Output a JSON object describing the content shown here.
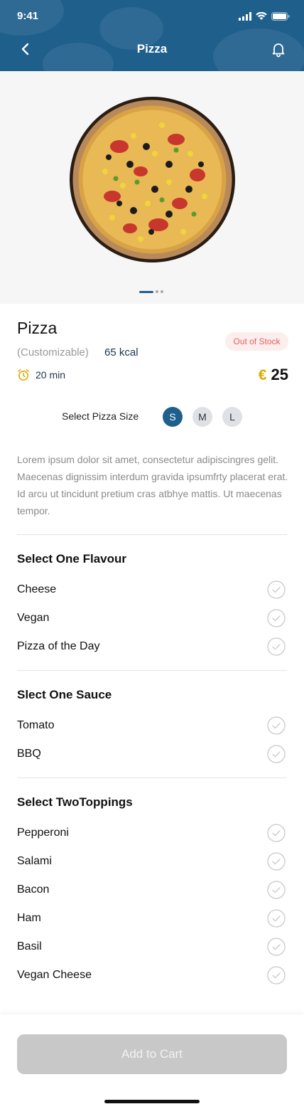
{
  "status_bar": {
    "time": "9:41"
  },
  "nav": {
    "title": "Pizza"
  },
  "product": {
    "name": "Pizza",
    "customizable": "(Customizable)",
    "kcal": "65 kcal",
    "stock_badge": "Out of Stock",
    "time": "20 min",
    "currency": "€",
    "price": "25",
    "size_label": "Select Pizza Size",
    "sizes": [
      "S",
      "M",
      "L"
    ],
    "selected_size": "S",
    "description": "Lorem ipsum dolor sit amet, consectetur adipiscingres gelit. Maecenas dignissim interdum gravida ipsumfrty placerat erat. Id arcu ut tincidunt pretium cras atbhye mattis. Ut maecenas tempor."
  },
  "sections": [
    {
      "title": "Select One Flavour",
      "options": [
        "Cheese",
        "Vegan",
        "Pizza of the Day"
      ]
    },
    {
      "title": "Slect One Sauce",
      "options": [
        "Tomato",
        "BBQ"
      ]
    },
    {
      "title": "Select TwoToppings",
      "options": [
        "Pepperoni",
        "Salami",
        "Bacon",
        "Ham",
        "Basil",
        "Vegan Cheese"
      ]
    }
  ],
  "carousel": {
    "pages": 3,
    "active": 1
  },
  "cart_button": {
    "label": "Add to Cart"
  },
  "colors": {
    "brand": "#1f5f8b",
    "price_currency": "#e0a800",
    "stock_text": "#e06060",
    "disabled_button": "#c8c8c8"
  }
}
